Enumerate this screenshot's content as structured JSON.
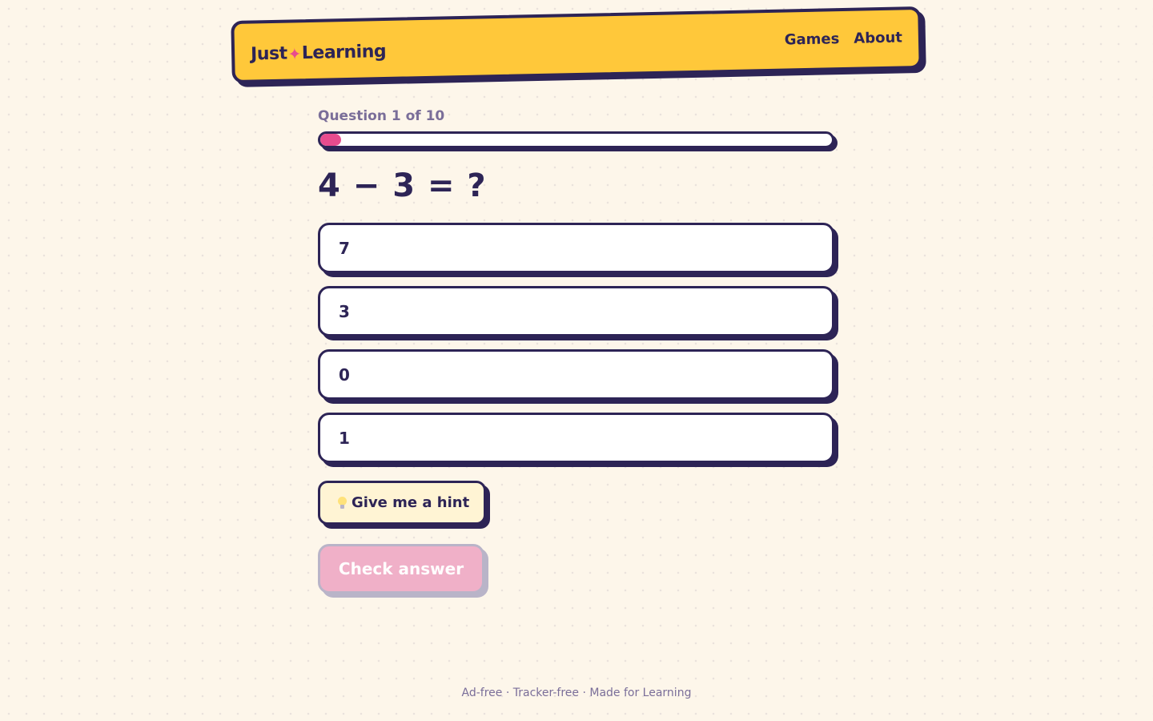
{
  "header": {
    "logo_left": "Just",
    "logo_star": "✦",
    "logo_right": "Learning",
    "nav": [
      {
        "label": "Games"
      },
      {
        "label": "About"
      }
    ]
  },
  "quiz": {
    "counter": "Question 1 of 10",
    "progress_fraction": 0.04,
    "question": "4 − 3 = ?",
    "options": [
      {
        "label": "7"
      },
      {
        "label": "3"
      },
      {
        "label": "0"
      },
      {
        "label": "1"
      }
    ],
    "hint_label": "Give me a hint",
    "hint_icon": "lightbulb-icon",
    "check_label": "Check answer"
  },
  "footer": {
    "text": "Ad-free · Tracker-free · Made for Learning"
  },
  "colors": {
    "background": "#fdf6ea",
    "header": "#ffc83a",
    "ink": "#2d2456",
    "accent": "#e84c8e",
    "muted": "#7a6e99",
    "check_disabled": "#f0b0c8"
  }
}
